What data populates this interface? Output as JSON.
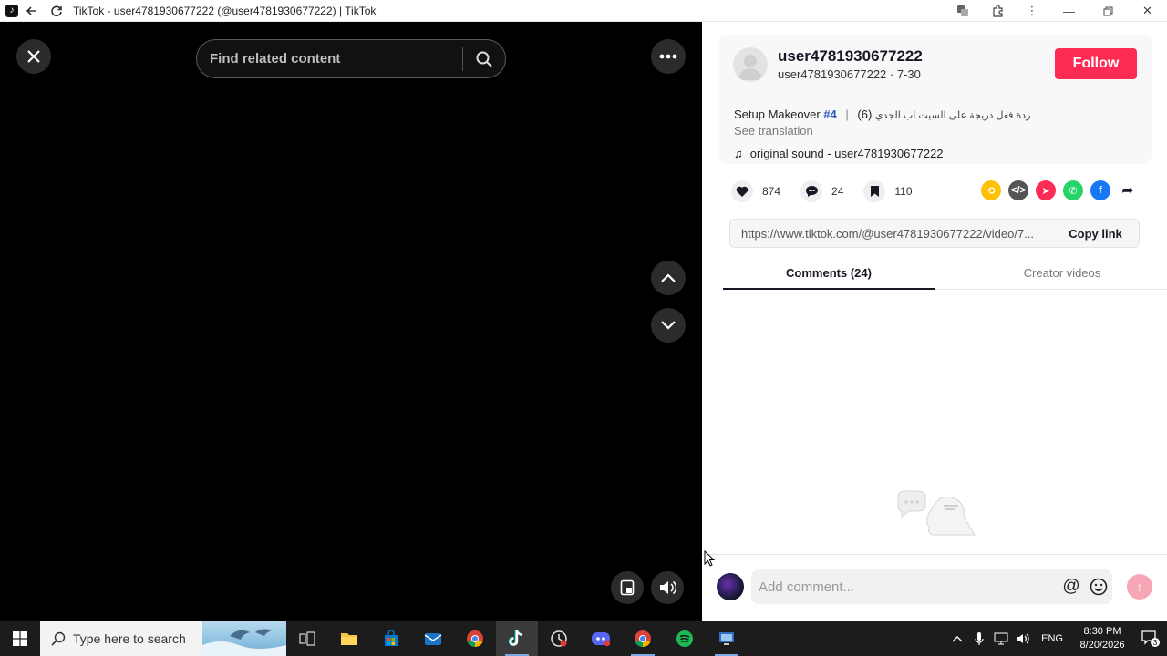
{
  "window": {
    "title": "TikTok - user4781930677222 (@user4781930677222) | TikTok"
  },
  "video": {
    "search_placeholder": "Find related content"
  },
  "post": {
    "username": "user4781930677222",
    "subline": "user4781930677222 · 7-30",
    "follow_label": "Follow",
    "description_prefix": "Setup Makeover",
    "hashtag": "#4",
    "description_sep": "|",
    "description_count": "(6)",
    "description_arabic": "ردة فعل دريجة على السيت اب الجدي",
    "see_translation": "See translation",
    "sound": "original sound - user4781930677222",
    "likes": "874",
    "comments": "24",
    "saves": "110",
    "link_url": "https://www.tiktok.com/@user4781930677222/video/7...",
    "copy_link_label": "Copy link"
  },
  "tabs": [
    {
      "label": "Comments (24)"
    },
    {
      "label": "Creator videos"
    }
  ],
  "comment_box": {
    "placeholder": "Add comment..."
  },
  "taskbar": {
    "search_placeholder": "Type here to search",
    "language": "ENG",
    "time": "8:30 PM",
    "date": "8/20/2026",
    "notification_count": "3"
  },
  "colors": {
    "follow": "#fe2c55",
    "hashtag": "#2b5db6"
  }
}
